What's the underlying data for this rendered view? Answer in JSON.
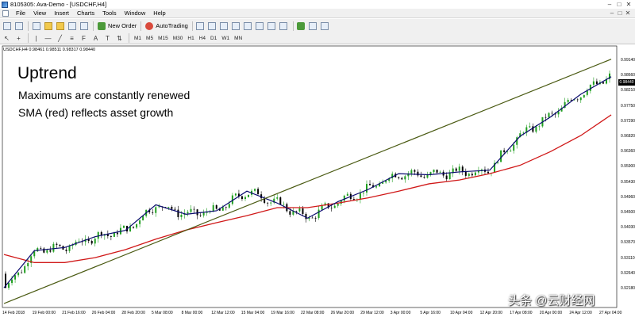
{
  "window": {
    "title": "8105305: Ava-Demo - [USDCHF,H4]",
    "controls": [
      "–",
      "□",
      "✕"
    ]
  },
  "menu": {
    "items": [
      "File",
      "View",
      "Insert",
      "Charts",
      "Tools",
      "Window",
      "Help"
    ],
    "right_controls": [
      "–",
      "□",
      "✕"
    ]
  },
  "toolbar": {
    "new_order_label": "New Order",
    "autotrading_label": "AutoTrading",
    "timeframes": [
      "M1",
      "M5",
      "M15",
      "M30",
      "H1",
      "H4",
      "D1",
      "W1",
      "MN"
    ]
  },
  "chart": {
    "header": "USDCHF,H4  0.98461 0.98511 0.98317 0.98440",
    "current_price": "0.98440",
    "overlay_title": "Uptrend",
    "overlay_line1": "Maximums are constantly renewed",
    "overlay_line2": "SMA (red) reflects asset growth",
    "y_ticks": [
      "0.99140",
      "0.98660",
      "0.98210",
      "0.97750",
      "0.97290",
      "0.96820",
      "0.96360",
      "0.95900",
      "0.95430",
      "0.94960",
      "0.94500",
      "0.94030",
      "0.93570",
      "0.93110",
      "0.92640",
      "0.92180"
    ],
    "x_ticks": [
      "14 Feb 2018",
      "19 Feb 00:00",
      "21 Feb 16:00",
      "26 Feb 04:00",
      "28 Feb 20:00",
      "5 Mar 08:00",
      "8 Mar 00:00",
      "12 Mar 12:00",
      "15 Mar 04:00",
      "19 Mar 16:00",
      "22 Mar 08:00",
      "26 Mar 20:00",
      "29 Mar 12:00",
      "3 Apr 00:00",
      "5 Apr 16:00",
      "10 Apr 04:00",
      "12 Apr 20:00",
      "17 Apr 08:00",
      "20 Apr 00:00",
      "24 Apr 12:00",
      "27 Apr 04:00"
    ],
    "colors": {
      "bull_candle": "#1f9e1f",
      "bear_candle": "#000000",
      "fast_ma": "#0a0a6e",
      "sma": "#d01818",
      "trendline": "#4a5a12"
    }
  },
  "watermark": "头条 @云财经网",
  "chart_data": {
    "type": "line",
    "x": [
      "14 Feb 2018",
      "19 Feb 00:00",
      "21 Feb 16:00",
      "26 Feb 04:00",
      "28 Feb 20:00",
      "5 Mar 08:00",
      "8 Mar 00:00",
      "12 Mar 12:00",
      "15 Mar 04:00",
      "19 Mar 16:00",
      "22 Mar 08:00",
      "26 Mar 20:00",
      "29 Mar 12:00",
      "3 Apr 00:00",
      "5 Apr 16:00",
      "10 Apr 04:00",
      "12 Apr 20:00",
      "17 Apr 08:00",
      "20 Apr 00:00",
      "24 Apr 12:00",
      "27 Apr 04:00"
    ],
    "series": [
      {
        "values": [
          0.9255,
          0.9361,
          0.937,
          0.9401,
          0.9419,
          0.9492,
          0.9465,
          0.9475,
          0.9531,
          0.9497,
          0.9454,
          0.9501,
          0.9536,
          0.9581,
          0.9578,
          0.9586,
          0.9591,
          0.9688,
          0.9743,
          0.9808,
          0.9858
        ]
      },
      {
        "name": "SMA",
        "values": [
          0.935,
          0.9327,
          0.9327,
          0.9341,
          0.9364,
          0.9394,
          0.942,
          0.9441,
          0.9461,
          0.9484,
          0.9484,
          0.9497,
          0.9512,
          0.9531,
          0.9552,
          0.9563,
          0.9581,
          0.9605,
          0.9644,
          0.969,
          0.9749
        ]
      },
      {
        "name": "Trendline",
        "values": [
          0.921,
          0.9245,
          0.928,
          0.9314,
          0.9351,
          0.9385,
          0.942,
          0.9455,
          0.9489,
          0.9524,
          0.9558,
          0.9595,
          0.9629,
          0.9664,
          0.9699,
          0.9733,
          0.977,
          0.9804,
          0.9839,
          0.9874,
          0.9908
        ]
      }
    ],
    "ylim": [
      0.921,
      0.993
    ],
    "grid": false
  }
}
